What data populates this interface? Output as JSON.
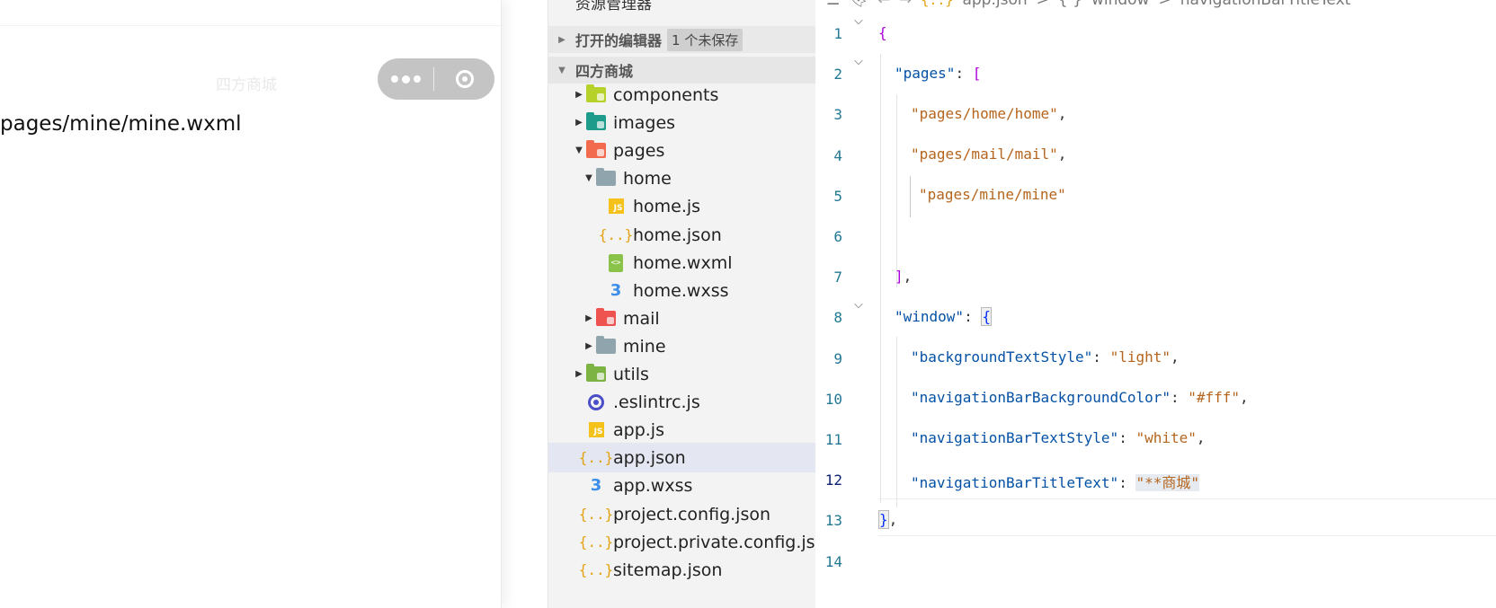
{
  "simulator": {
    "nav_title": "四方商城",
    "page_text": "pages/mine/mine.wxml",
    "capsule": {
      "more_icon": "more-dots-icon",
      "close_icon": "target-close-icon"
    }
  },
  "explorer": {
    "title": "资源管理器",
    "more_label": "···",
    "open_editors": {
      "label": "打开的编辑器",
      "badge": "1 个未保存"
    },
    "project": {
      "label": "四方商城"
    },
    "tree": [
      {
        "label": "components",
        "type": "folder",
        "icon": "components-folder-icon",
        "color": "#b5d12a",
        "expanded": false,
        "depth": 0
      },
      {
        "label": "images",
        "type": "folder",
        "icon": "images-folder-icon",
        "color": "#1f9b8c",
        "expanded": false,
        "depth": 0
      },
      {
        "label": "pages",
        "type": "folder",
        "icon": "pages-folder-icon",
        "color": "#f26b4f",
        "expanded": true,
        "depth": 0
      },
      {
        "label": "home",
        "type": "folder",
        "icon": "open-folder-icon",
        "color": "#90a4ae",
        "expanded": true,
        "depth": 1
      },
      {
        "label": "home.js",
        "type": "js",
        "icon": "js-file-icon",
        "depth": 2
      },
      {
        "label": "home.json",
        "type": "json",
        "icon": "json-file-icon",
        "depth": 2
      },
      {
        "label": "home.wxml",
        "type": "wxml",
        "icon": "wxml-file-icon",
        "depth": 2
      },
      {
        "label": "home.wxss",
        "type": "wxss",
        "icon": "css-file-icon",
        "depth": 2
      },
      {
        "label": "mail",
        "type": "folder",
        "icon": "mail-folder-icon",
        "color": "#ef5350",
        "expanded": false,
        "depth": 1
      },
      {
        "label": "mine",
        "type": "folder",
        "icon": "folder-icon",
        "color": "#90a4ae",
        "expanded": false,
        "depth": 1
      },
      {
        "label": "utils",
        "type": "folder",
        "icon": "utils-folder-icon",
        "color": "#7cb342",
        "expanded": false,
        "depth": 0
      },
      {
        "label": ".eslintrc.js",
        "type": "eslint",
        "icon": "eslint-icon",
        "depth": 0
      },
      {
        "label": "app.js",
        "type": "js",
        "icon": "js-file-icon",
        "depth": 0
      },
      {
        "label": "app.json",
        "type": "json",
        "icon": "json-file-icon",
        "depth": 0,
        "selected": true
      },
      {
        "label": "app.wxss",
        "type": "wxss",
        "icon": "css-file-icon",
        "depth": 0
      },
      {
        "label": "project.config.json",
        "type": "json",
        "icon": "json-file-icon",
        "depth": 0
      },
      {
        "label": "project.private.config.js...",
        "type": "json",
        "icon": "json-file-icon",
        "depth": 0
      },
      {
        "label": "sitemap.json",
        "type": "json",
        "icon": "json-file-icon",
        "depth": 0
      }
    ]
  },
  "editor": {
    "breadcrumb": {
      "icons": [
        "outline-icon",
        "bookmark-icon",
        "back-arrow-icon",
        "forward-arrow-icon"
      ],
      "file_icon_text": "{..}",
      "file": "app.json",
      "sep1": ">",
      "symbol_icon": "{ }",
      "symbol": "window",
      "sep2": ">",
      "property": "navigationBarTitleText"
    },
    "active_line": 12,
    "lines": [
      {
        "n": "1",
        "fold": true
      },
      {
        "n": "2",
        "fold": true
      },
      {
        "n": "3"
      },
      {
        "n": "4"
      },
      {
        "n": "5"
      },
      {
        "n": "6"
      },
      {
        "n": "7"
      },
      {
        "n": "8",
        "fold": true
      },
      {
        "n": "9"
      },
      {
        "n": "10"
      },
      {
        "n": "11"
      },
      {
        "n": "12"
      },
      {
        "n": "13"
      },
      {
        "n": "14"
      }
    ],
    "code": {
      "l1_open": "{",
      "l2_key": "\"pages\"",
      "l2_colon": ": ",
      "l2_bracket": "[",
      "l3": "\"pages/home/home\"",
      "l3_comma": ",",
      "l4": "\"pages/mail/mail\"",
      "l4_comma": ",",
      "l5": "\"pages/mine/mine\"",
      "l7_bracket": "]",
      "l7_comma": ",",
      "l8_key": "\"window\"",
      "l8_colon": ": ",
      "l8_brace": "{",
      "l9_key": "\"backgroundTextStyle\"",
      "l9_colon": ": ",
      "l9_val": "\"light\"",
      "l9_comma": ",",
      "l10_key": "\"navigationBarBackgroundColor\"",
      "l10_colon": ": ",
      "l10_val": "\"#fff\"",
      "l10_comma": ",",
      "l11_key": "\"navigationBarTextStyle\"",
      "l11_colon": ": ",
      "l11_val": "\"white\"",
      "l11_comma": ",",
      "l12_key": "\"navigationBarTitleText\"",
      "l12_colon": ": ",
      "l12_q1": "\"",
      "l12_val": "**商城",
      "l12_q2": "\"",
      "l13_brace": "}",
      "l13_comma": ","
    }
  },
  "colors": {
    "selected_row": "#e4e6f1",
    "key": "#0451a5",
    "string": "#a31515",
    "bracket": "#af00db",
    "line_number": "#237893"
  }
}
